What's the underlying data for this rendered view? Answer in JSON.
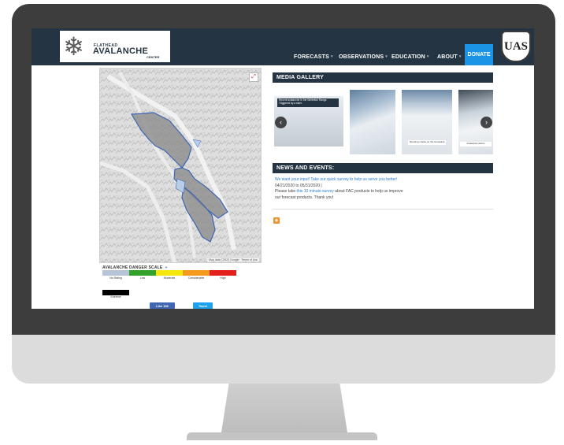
{
  "header": {
    "logo": {
      "small_text": "FLATHEAD",
      "big_text": "AVALANCHE",
      "sub_text": "CENTER"
    },
    "nav": [
      {
        "label": "FORECASTS"
      },
      {
        "label": "OBSERVATIONS"
      },
      {
        "label": "EDUCATION"
      },
      {
        "label": "ABOUT"
      }
    ],
    "donate_label": "DONATE",
    "badge_text": "UAS"
  },
  "map": {
    "attribution": "Map data ©2020 Google · Terms of Use"
  },
  "danger_scale": {
    "title": "AVALANCHE DANGER SCALE",
    "toggle": "+",
    "levels": [
      {
        "label": "No Rating",
        "color": "#b5c4d6"
      },
      {
        "label": "Low",
        "color": "#34a12a"
      },
      {
        "label": "Moderate",
        "color": "#f5e70e"
      },
      {
        "label": "Considerable",
        "color": "#f39a1f"
      },
      {
        "label": "High",
        "color": "#e3201b"
      }
    ],
    "extreme": {
      "label": "Extreme",
      "color": "#000000"
    }
  },
  "social": {
    "like_label": "Like 196",
    "tweet_label": "Tweet"
  },
  "media_gallery": {
    "title": "MEDIA GALLERY",
    "items": [
      {
        "caption": "Recent avalanche in the Whitefish Range. Triggered by a skier."
      },
      {
        "caption": ""
      },
      {
        "caption": "Shooting cracks on the snowpack"
      },
      {
        "caption": "Avalanche debris"
      }
    ]
  },
  "news": {
    "title": "NEWS AND EVENTS:",
    "headline": "We want your input! Take our quick survey to help us serve you better!",
    "dates": "04/21/2020 to 05/31/2020 |",
    "body_before_link": "Please take ",
    "link_text": "this 10 minute survey",
    "body_after_link": " about FAC products to help us improve",
    "body_line3": "our forecast products. Thank you!"
  },
  "colors": {
    "header_bg": "#253443",
    "donate_bg": "#1b94e5",
    "forecast_zone": "#8c8c8c",
    "link": "#2b7bd0"
  }
}
